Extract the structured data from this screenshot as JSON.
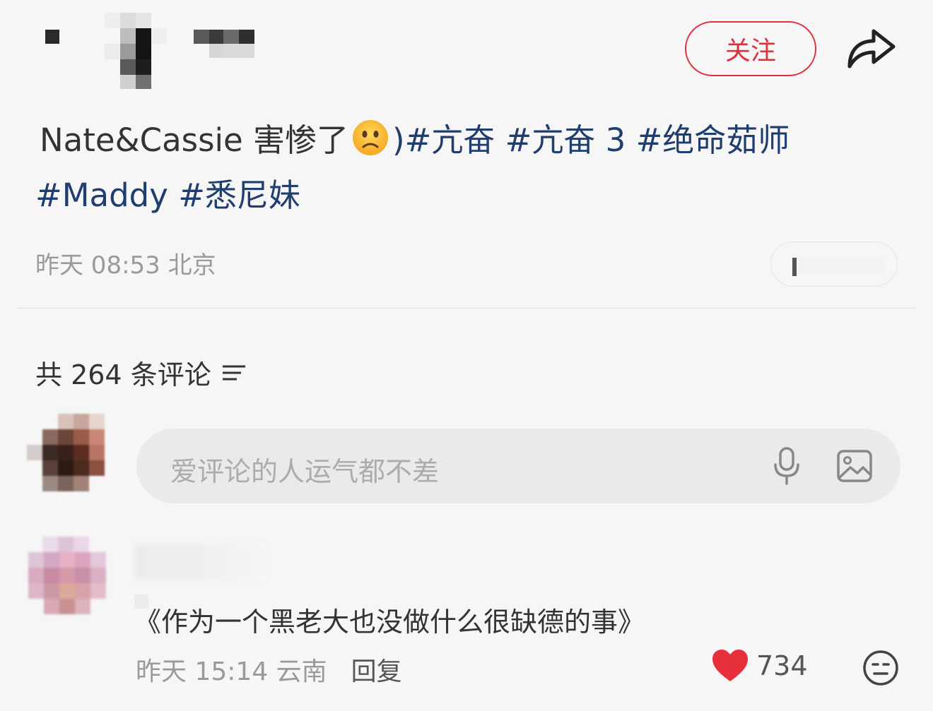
{
  "header": {
    "follow_label": "关注"
  },
  "note": {
    "text_plain": "Nate&Cassie 害惨了",
    "text_after_emoji": ")",
    "tags_line1": [
      "#亢奋",
      "#亢奋 3",
      "#绝命茹师"
    ],
    "tags_line2": [
      "#Maddy",
      "#悉尼妹"
    ],
    "date": "昨天 08:53",
    "location": "北京"
  },
  "comments": {
    "count_label": "共 264 条评论",
    "input_placeholder": "爱评论的人运气都不差",
    "items": [
      {
        "text": "《作为一个黑老大也没做什么很缺德的事》",
        "date": "昨天 15:14",
        "location": "云南",
        "reply_label": "回复",
        "likes": "734"
      }
    ]
  },
  "colors": {
    "accent": "#e0303f",
    "tag": "#1f3d6e",
    "like": "#e8303c"
  }
}
